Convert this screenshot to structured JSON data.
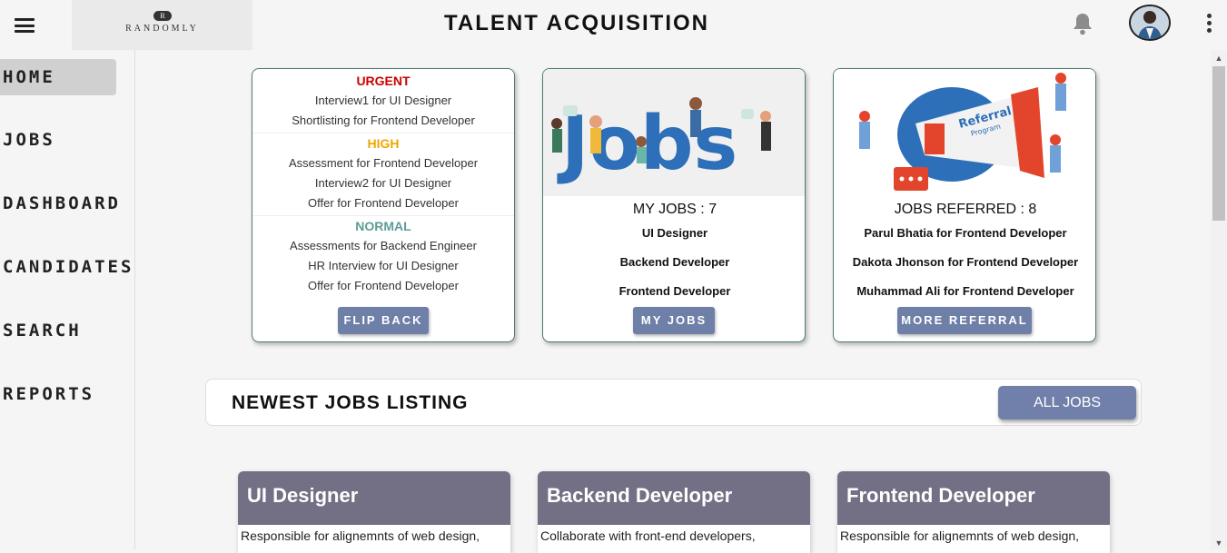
{
  "header": {
    "logo_text": "RANDOMLY",
    "logo_mark": "R",
    "title": "TALENT ACQUISITION"
  },
  "sidebar": {
    "items": [
      {
        "label": "HOME",
        "active": true
      },
      {
        "label": "JOBS"
      },
      {
        "label": "DASHBOARD"
      },
      {
        "label": "CANDIDATES"
      },
      {
        "label": "SEARCH"
      },
      {
        "label": "REPORTS"
      }
    ]
  },
  "priority_card": {
    "urgent": {
      "heading": "URGENT",
      "color": "#cc0000",
      "items": [
        "Interview1 for UI Designer",
        "Shortlisting for Frontend Developer"
      ]
    },
    "high": {
      "heading": "HIGH",
      "color": "#f0a500",
      "items": [
        "Assessment for Frontend Developer",
        "Interview2 for UI Designer",
        "Offer for Frontend Developer"
      ]
    },
    "normal": {
      "heading": "NORMAL",
      "color": "#5f9c98",
      "items": [
        "Assessments for Backend Engineer",
        "HR Interview for UI Designer",
        "Offer for Frontend Developer"
      ]
    },
    "button": "FLIP BACK"
  },
  "jobs_card": {
    "image_text": "Jobs",
    "title": "MY JOBS : 7",
    "items": [
      "UI Designer",
      "Backend Developer",
      "Frontend Developer"
    ],
    "button": "MY JOBS"
  },
  "referral_card": {
    "image_text": "Referral",
    "image_subtext": "Program",
    "title": "JOBS REFERRED : 8",
    "items": [
      "Parul Bhatia for Frontend Developer",
      "Dakota Jhonson for Frontend Developer",
      "Muhammad Ali for Frontend Developer"
    ],
    "button": "MORE REFERRAL"
  },
  "listing": {
    "title": "NEWEST JOBS LISTING",
    "button": "ALL JOBS"
  },
  "job_cards": [
    {
      "title": "UI Designer",
      "description": "Responsible for alignemnts of web design,"
    },
    {
      "title": "Backend Developer",
      "description": "Collaborate with front-end developers,"
    },
    {
      "title": "Frontend Developer",
      "description": "Responsible for alignemnts of web design,"
    }
  ],
  "icons": {
    "menu": "hamburger-menu-icon",
    "notifications": "bell-icon",
    "more": "kebab-menu-icon"
  }
}
